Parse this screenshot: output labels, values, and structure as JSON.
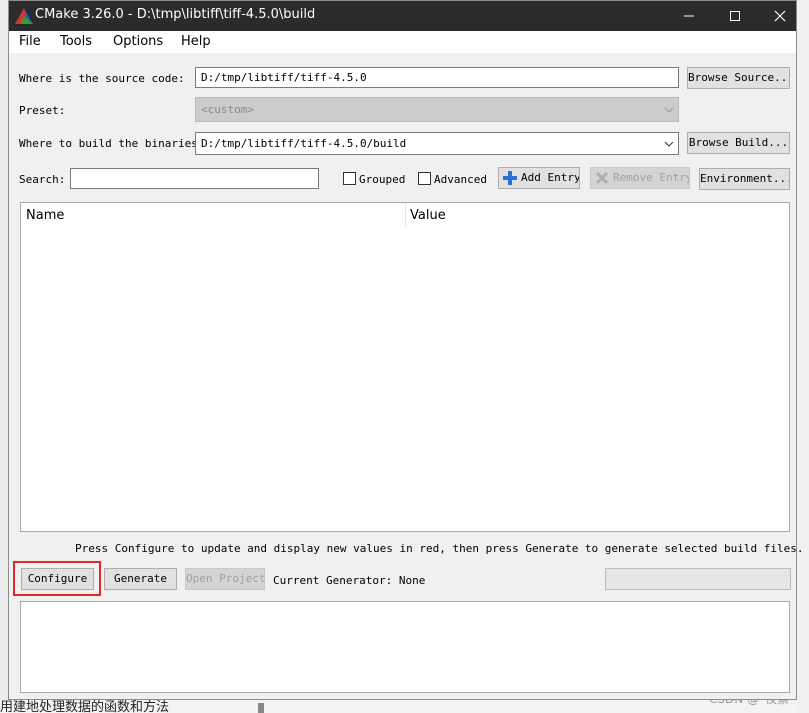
{
  "window": {
    "title": "CMake 3.26.0 - D:\\tmp\\libtiff\\tiff-4.5.0\\build"
  },
  "menu": {
    "file": "File",
    "tools": "Tools",
    "options": "Options",
    "help": "Help"
  },
  "source": {
    "label": "Where is the source code:",
    "value": "D:/tmp/libtiff/tiff-4.5.0",
    "browse_label": "Browse Source..."
  },
  "preset": {
    "label": "Preset:",
    "value": "<custom>"
  },
  "build": {
    "label": "Where to build the binaries:",
    "value": "D:/tmp/libtiff/tiff-4.5.0/build",
    "browse_label": "Browse Build..."
  },
  "search": {
    "label": "Search:",
    "value": ""
  },
  "options": {
    "grouped_label": "Grouped",
    "grouped_checked": false,
    "advanced_label": "Advanced",
    "advanced_checked": false,
    "add_entry_label": "Add Entry",
    "remove_entry_label": "Remove Entry",
    "environment_label": "Environment..."
  },
  "table": {
    "columns": [
      "Name",
      "Value"
    ],
    "rows": []
  },
  "hint": "Press Configure to update and display new values in red, then press Generate to generate selected build files.",
  "actions": {
    "configure_label": "Configure",
    "generate_label": "Generate",
    "open_project_label": "Open Project",
    "current_generator": "Current Generator: None"
  },
  "background": {
    "bottom_text": "用建地处理数据的函数和方法",
    "watermark": "CSDN @*夜紫*"
  },
  "colors": {
    "titlebar": "#2b2b2b",
    "highlight": "#e0262d",
    "add_icon": "#2a6fd6"
  }
}
